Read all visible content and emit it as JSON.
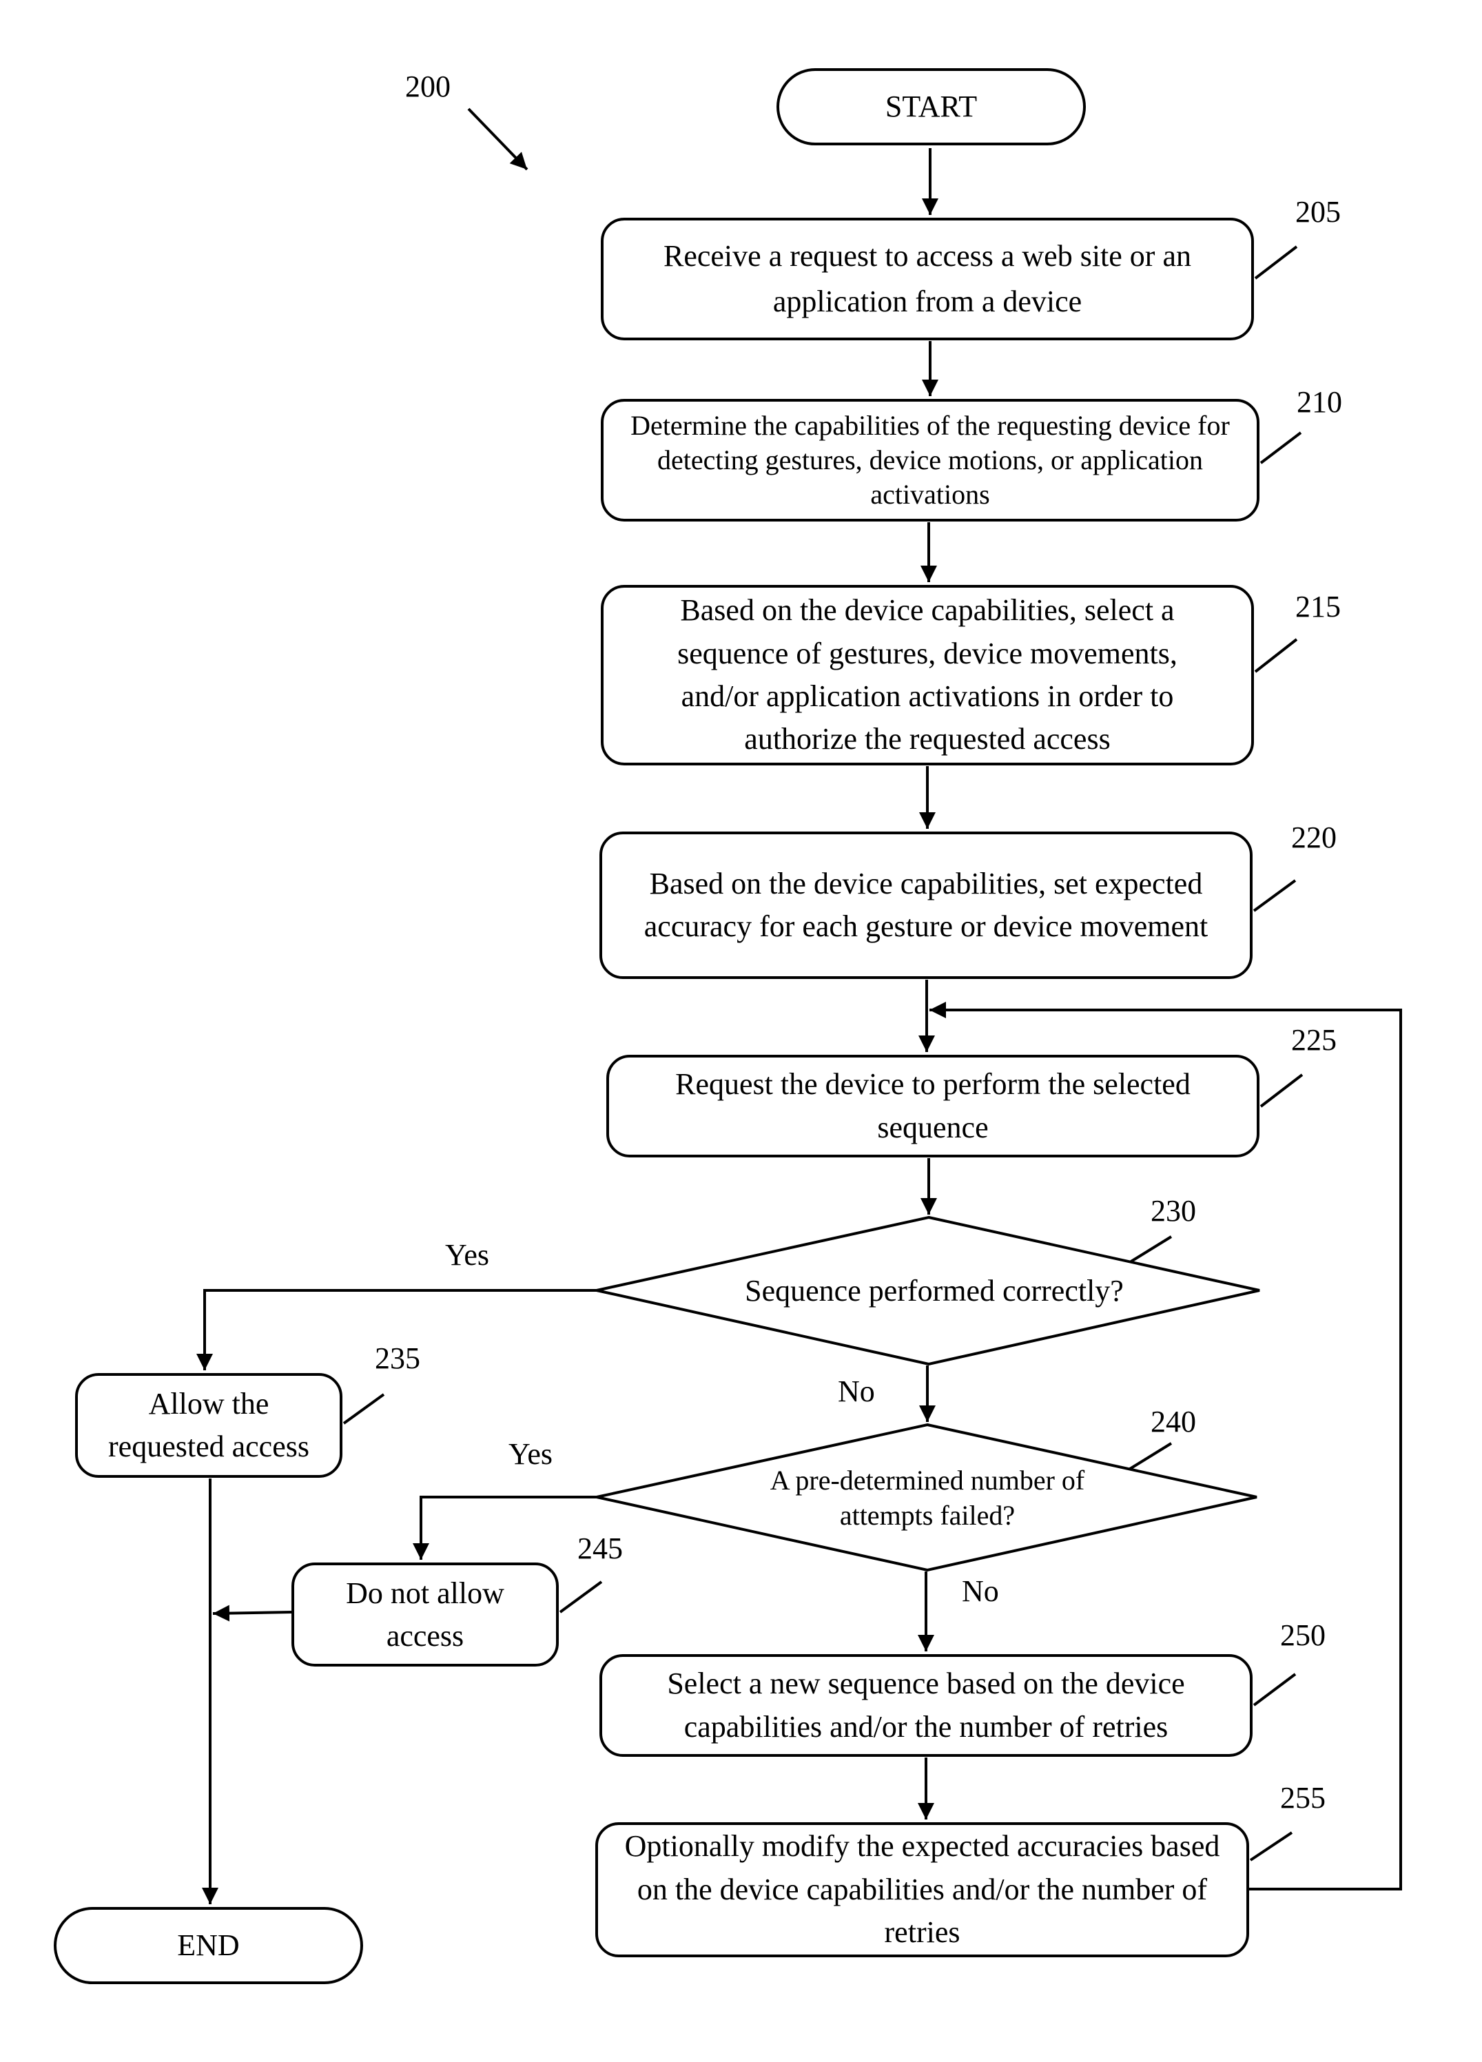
{
  "figure": {
    "ref": "200"
  },
  "nodes": {
    "start": {
      "label": "START"
    },
    "n205": {
      "ref": "205",
      "text": "Receive a request to access a web site or an application from a device"
    },
    "n210": {
      "ref": "210",
      "text": "Determine the capabilities of the requesting device for detecting gestures, device motions, or application activations"
    },
    "n215": {
      "ref": "215",
      "text": "Based on the device capabilities, select a sequence of gestures,  device movements, and/or application activations in order to authorize the requested access"
    },
    "n220": {
      "ref": "220",
      "text": "Based on the device capabilities, set expected accuracy for each gesture or device movement"
    },
    "n225": {
      "ref": "225",
      "text": "Request the device to perform the selected sequence"
    },
    "d230": {
      "ref": "230",
      "text": "Sequence performed correctly?",
      "yes": "Yes",
      "no": "No"
    },
    "n235": {
      "ref": "235",
      "text": "Allow the requested access"
    },
    "d240": {
      "ref": "240",
      "text": "A pre-determined number of attempts failed?",
      "yes": "Yes",
      "no": "No"
    },
    "n245": {
      "ref": "245",
      "text": "Do not allow access"
    },
    "n250": {
      "ref": "250",
      "text": "Select a new sequence based on the device capabilities and/or the number of retries"
    },
    "n255": {
      "ref": "255",
      "text": "Optionally modify the expected accuracies based on the device capabilities and/or the number of retries"
    },
    "end": {
      "label": "END"
    }
  }
}
